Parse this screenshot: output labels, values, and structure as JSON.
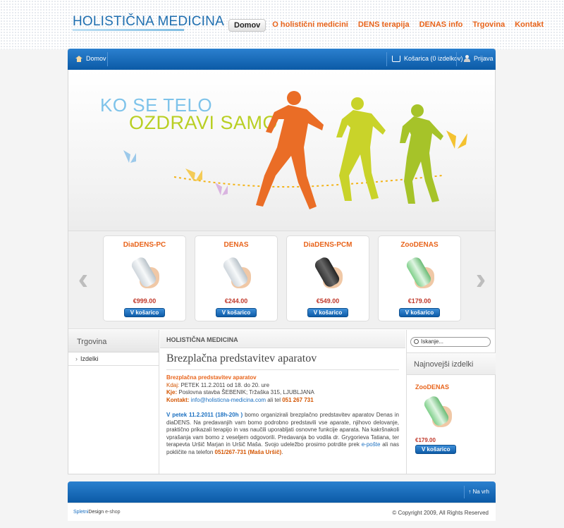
{
  "brand": {
    "name": "HOLISTIČNA MEDICINA"
  },
  "topnav": [
    {
      "label": "Domov",
      "active": true
    },
    {
      "label": "O holistični medicini"
    },
    {
      "label": "DENS terapija"
    },
    {
      "label": "DENAS info"
    },
    {
      "label": "Trgovina"
    },
    {
      "label": "Kontakt"
    }
  ],
  "bar": {
    "home": "Domov",
    "cart": "Košarica (0 izdelkov)",
    "login": "Prijava"
  },
  "hero": {
    "line1": "KO SE TELO",
    "line2": "OZDRAVI SAMO"
  },
  "products": [
    {
      "name": "DiaDENS-PC",
      "price": "€999.00",
      "button": "V košarico"
    },
    {
      "name": "DENAS",
      "price": "€244.00",
      "button": "V košarico"
    },
    {
      "name": "DiaDENS-PCM",
      "price": "€549.00",
      "button": "V košarico"
    },
    {
      "name": "ZooDENAS",
      "price": "€179.00",
      "button": "V košarico"
    }
  ],
  "left": {
    "title": "Trgovina",
    "items": [
      "Izdelki"
    ]
  },
  "main": {
    "header": "HOLISTIČNA MEDICINA",
    "title": "Brezplačna predstavitev aparatov",
    "event_title": "Brezplačna predstavitev aparatov",
    "when_label": "Kdaj:",
    "when": "PETEK 11.2.2011 od 18. do 20. ure",
    "where_label": "Kje:",
    "where": "Poslovna stavba ŠEBENIK; Tržaška 315, LJUBLJANA",
    "contact_label": "Kontakt:",
    "contact_email": "info@holisticna-medicina.com",
    "contact_mid": " ali tel ",
    "contact_phone": "051 267 731",
    "p_start": "V petek 11.2.2011 (18h-20h )",
    "p_body": " bomo organizirali brezplačno predstavitev aparatov Denas in diaDENS. Na predavanjih vam bomo podrobno predstavili vse aparate, njihovo delovanje, praktično prikazali terapijo in vas naučili uporabljati osnovne funkcije aparata. Na kakršnakoli vprašanja vam bomo z veseljem odgovorili. Predavanja bo vodila dr. Grygorieva Tatiana, ter terapevta Uršič Marjan in Uršič Maša. Svojo udeležbo prosimo potrdite prek ",
    "p_link": "e-pošte",
    "p_mid": " ali nas pokličite na telefon ",
    "p_phone": "051/267-731 (Maša Uršič)",
    "p_end": "."
  },
  "right": {
    "search_placeholder": "Iskanje...",
    "latest_title": "Najnovejši izdelki",
    "product": {
      "name": "ZooDENAS",
      "price": "€179.00",
      "button": "V košarico"
    }
  },
  "footer": {
    "top": "Na vrh",
    "left_a": "Spletni",
    "left_b": "Design",
    "left_c": " e-shop",
    "copyright": "© Copyright 2009, All Rights Reserved"
  }
}
